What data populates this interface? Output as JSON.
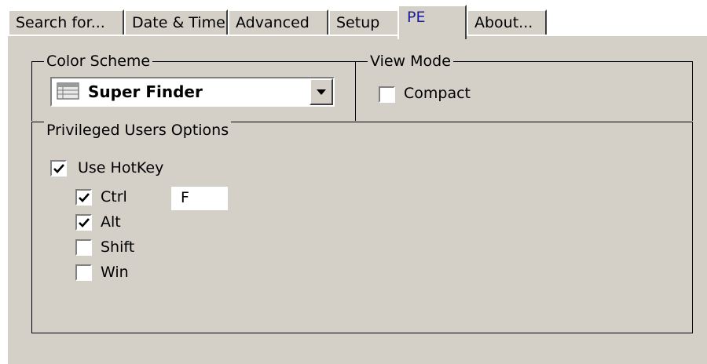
{
  "tabs": [
    {
      "label": "Search for...",
      "active": false
    },
    {
      "label": "Date & Time",
      "active": false
    },
    {
      "label": "Advanced",
      "active": false
    },
    {
      "label": "Setup",
      "active": false
    },
    {
      "label": "PE",
      "active": true
    },
    {
      "label": "About...",
      "active": false
    }
  ],
  "color_scheme": {
    "legend": "Color Scheme",
    "selected_value": "Super Finder",
    "icon": "palette-icon"
  },
  "view_mode": {
    "legend": "View Mode",
    "compact": {
      "label": "Compact",
      "checked": false
    }
  },
  "privileged": {
    "legend": "Privileged Users Options",
    "use_hotkey": {
      "label": "Use HotKey",
      "checked": true
    },
    "ctrl": {
      "label": "Ctrl",
      "checked": true
    },
    "alt": {
      "label": "Alt",
      "checked": true
    },
    "shift": {
      "label": "Shift",
      "checked": false
    },
    "win": {
      "label": "Win",
      "checked": false
    },
    "key_value": "F"
  },
  "colors": {
    "face": "#d4d0c8",
    "active_tab_text": "#1a1aa0"
  }
}
